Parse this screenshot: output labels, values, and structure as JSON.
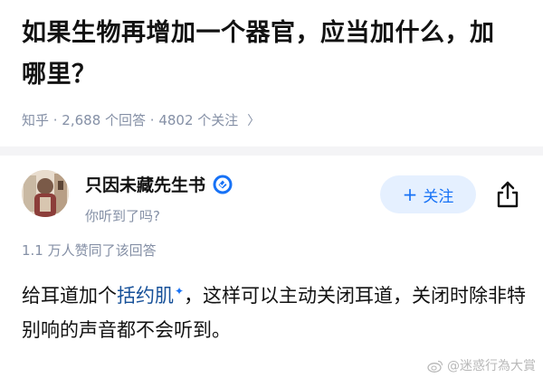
{
  "question": {
    "title_line1": "如果生物再增加一个器官，应当加什么，加",
    "title_line2": "哪里？",
    "meta": "知乎 · 2,688 个回答 · 4802 个关注",
    "meta_chevron": "〉"
  },
  "answer": {
    "author_name": "只因未藏先生书",
    "author_bio": "你听到了吗?",
    "follow_plus": "+",
    "follow_label": "关注",
    "upvote_text": "1.1 万人赞同了该回答",
    "content_before": "给耳道加个",
    "content_keyword": "括约肌",
    "content_keyword_mark": "✦",
    "content_after": "，这样可以主动关闭耳道，关闭时除非特别响的声音都不会听到。"
  },
  "watermark": {
    "text": "@迷惑行為大賞"
  },
  "colors": {
    "accent": "#1772f6",
    "follow_bg": "#e5f0ff",
    "meta_gray": "#8590a6",
    "link": "#175199"
  }
}
